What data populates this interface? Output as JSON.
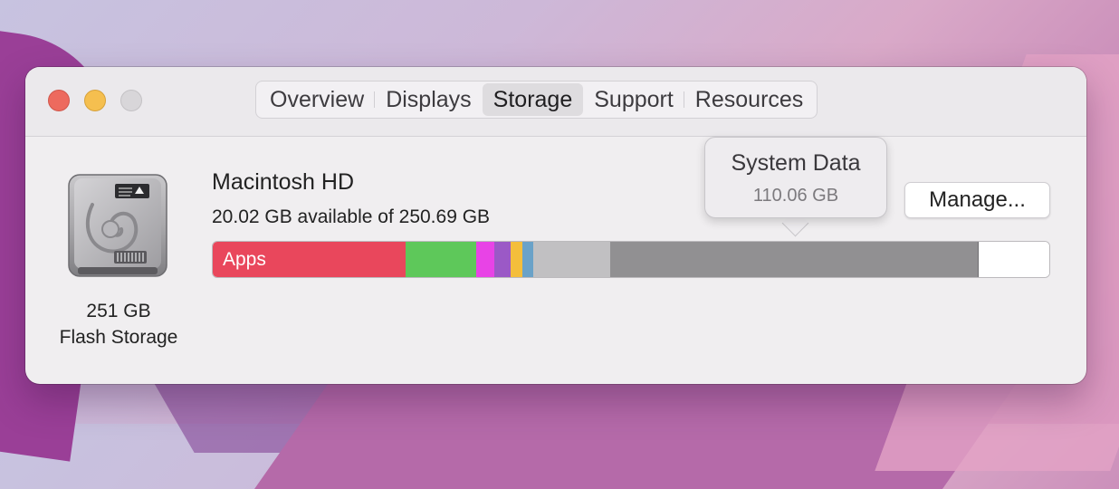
{
  "tabs": [
    {
      "label": "Overview"
    },
    {
      "label": "Displays"
    },
    {
      "label": "Storage",
      "active": true
    },
    {
      "label": "Support"
    },
    {
      "label": "Resources"
    }
  ],
  "disk": {
    "icon": "hard-drive-icon",
    "capacity": "251 GB",
    "type": "Flash Storage"
  },
  "volume": {
    "name": "Macintosh HD",
    "available": "20.02 GB available of 250.69 GB"
  },
  "storage_bar": {
    "apps_label": "Apps",
    "segments": [
      {
        "name": "Apps",
        "color": "#e9475c",
        "fraction": 0.231
      },
      {
        "name": "green",
        "color": "#5ec85a",
        "fraction": 0.084
      },
      {
        "name": "magenta",
        "color": "#e843e6",
        "fraction": 0.022
      },
      {
        "name": "purple",
        "color": "#9b59c6",
        "fraction": 0.019
      },
      {
        "name": "yellow",
        "color": "#f4be3b",
        "fraction": 0.015
      },
      {
        "name": "blue",
        "color": "#6aa2c8",
        "fraction": 0.013
      },
      {
        "name": "light-gray",
        "color": "#c1c0c2",
        "fraction": 0.092
      },
      {
        "name": "System Data",
        "color": "#919092",
        "fraction": 0.439
      },
      {
        "name": "free",
        "color": "#ffffff",
        "fraction": 0.085
      }
    ]
  },
  "tooltip": {
    "title": "System Data",
    "value": "110.06 GB"
  },
  "manage_button": {
    "label": "Manage..."
  },
  "colors": {
    "close": "#ed6a5e",
    "minimize": "#f5bf4f",
    "zoom": "#d8d6d9"
  }
}
